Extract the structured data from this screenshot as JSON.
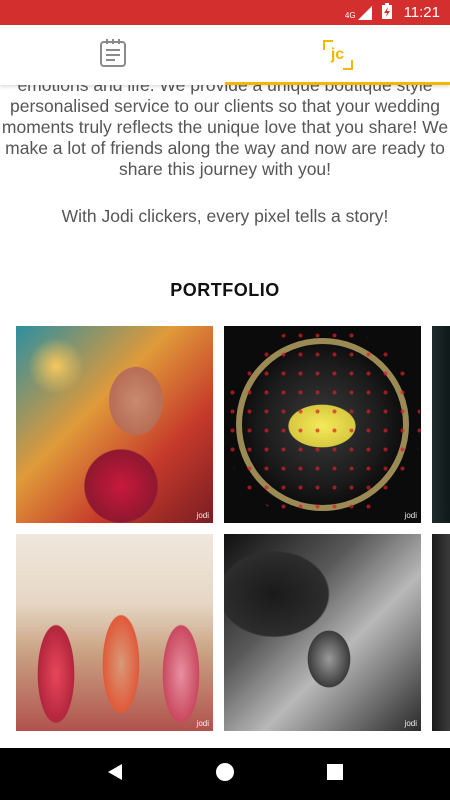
{
  "status_bar": {
    "network": "4G",
    "time": "11:21"
  },
  "tabs": [
    {
      "icon": "notes-icon",
      "active": false
    },
    {
      "icon": "jc-logo-icon",
      "label": "jc",
      "active": true
    }
  ],
  "about": {
    "text": "emotions and life. We provide a unique boutique style personalised service to our clients so that your wedding moments truly reflects the unique love that you share! We make a lot of friends along the way and now are ready to share this journey with you!",
    "tagline": "With Jodi clickers, every pixel tells a story!"
  },
  "portfolio": {
    "heading": "PORTFOLIO",
    "watermark": "jodi"
  },
  "nav": {
    "back_icon": "back-icon",
    "home_icon": "home-icon",
    "recents_icon": "recents-icon"
  },
  "colors": {
    "status_bar": "#d32f2f",
    "accent": "#f2b800",
    "text": "#555555"
  }
}
